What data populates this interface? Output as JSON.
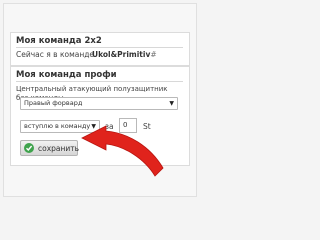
{
  "my_team": {
    "title": "Моя команда 2x2",
    "status_label": "Сейчас я в команде",
    "team_name": "Ukol&Primitiv",
    "team_suffix": "#"
  },
  "pro_team": {
    "title": "Моя команда профи",
    "description_line1": "Центральный атакующий полузащитник",
    "description_line2": "без команды",
    "position_select": {
      "value": "Правый форвард",
      "caret": "▼"
    },
    "action_select": {
      "value": "вступлю в команду",
      "caret": "▼"
    },
    "for_label": "за",
    "amount": "0",
    "currency": "St",
    "save_label": "сохранить"
  },
  "colors": {
    "arrow": "#e0231c",
    "save_icon": "#3fa34d"
  },
  "icons": {
    "save": "check-circle-icon",
    "pointer": "curved-arrow-icon"
  }
}
